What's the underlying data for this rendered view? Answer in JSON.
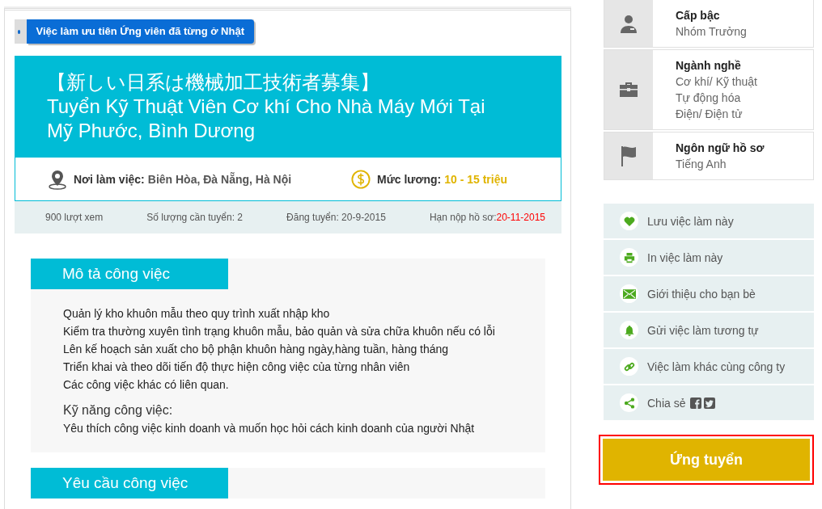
{
  "badge": {
    "label": "Việc làm ưu tiên Ứng viên đã từng ở Nhật"
  },
  "job": {
    "title_lines": [
      "【新しい日系は機械加工技術者募集】",
      "Tuyển Kỹ Thuật Viên Cơ khí Cho Nhà Máy Mới Tại",
      "Mỹ Phước, Bình Dương"
    ],
    "location_label": "Nơi làm việc:",
    "location": "Biên Hòa, Đà Nẵng, Hà Nội",
    "salary_label": "Mức lương:",
    "salary": "10 - 15 triệu"
  },
  "stats": [
    {
      "text": "900 lượt xem"
    },
    {
      "text": "Số lượng cần tuyển: 2"
    },
    {
      "text": "Đăng tuyển: 20-9-2015"
    },
    {
      "text": "Hạn nộp hồ sơ:",
      "highlight": "20-11-2015"
    }
  ],
  "sections": [
    {
      "title": "Mô tả công việc",
      "lines": [
        "Quản lý kho khuôn mẫu theo quy trình xuất nhập kho",
        "Kiểm tra thường xuyên tình trạng khuôn mẫu, bảo quản và sửa chữa khuôn nếu có lỗi",
        "Lên kế hoạch sản xuất cho bộ phận khuôn hàng ngày,hàng tuần, hàng tháng",
        "Triển khai và theo dõi tiến độ thực hiện công việc của từng nhân viên",
        "Các công việc khác có liên quan."
      ],
      "subheading": "Kỹ năng công việc:",
      "sub_lines": [
        "Yêu thích công việc kinh doanh và muốn học hỏi cách kinh doanh của người Nhật"
      ]
    },
    {
      "title": "Yêu cầu công việc"
    }
  ],
  "info": [
    {
      "kind": "person",
      "label": "Cấp bậc",
      "values": [
        "Nhóm Trưởng"
      ]
    },
    {
      "kind": "briefcase",
      "label": "Ngành nghề",
      "values": [
        "Cơ khí/ Kỹ thuật",
        "Tự động hóa",
        "Điện/ Điện tử"
      ]
    },
    {
      "kind": "flag",
      "label": "Ngôn ngữ hồ sơ",
      "values": [
        "Tiếng Anh"
      ]
    }
  ],
  "actions": [
    {
      "kind": "heart",
      "label": "Lưu việc làm này"
    },
    {
      "kind": "printer",
      "label": "In việc làm này"
    },
    {
      "kind": "mail",
      "label": "Giới thiệu cho bạn bè"
    },
    {
      "kind": "bell",
      "label": "Gửi việc làm tương tự"
    },
    {
      "kind": "link",
      "label": "Việc làm khác cùng công ty"
    },
    {
      "kind": "share",
      "label": "Chia sẻ"
    }
  ],
  "apply_button": {
    "label": "Ứng tuyển",
    "highlighted": true
  }
}
